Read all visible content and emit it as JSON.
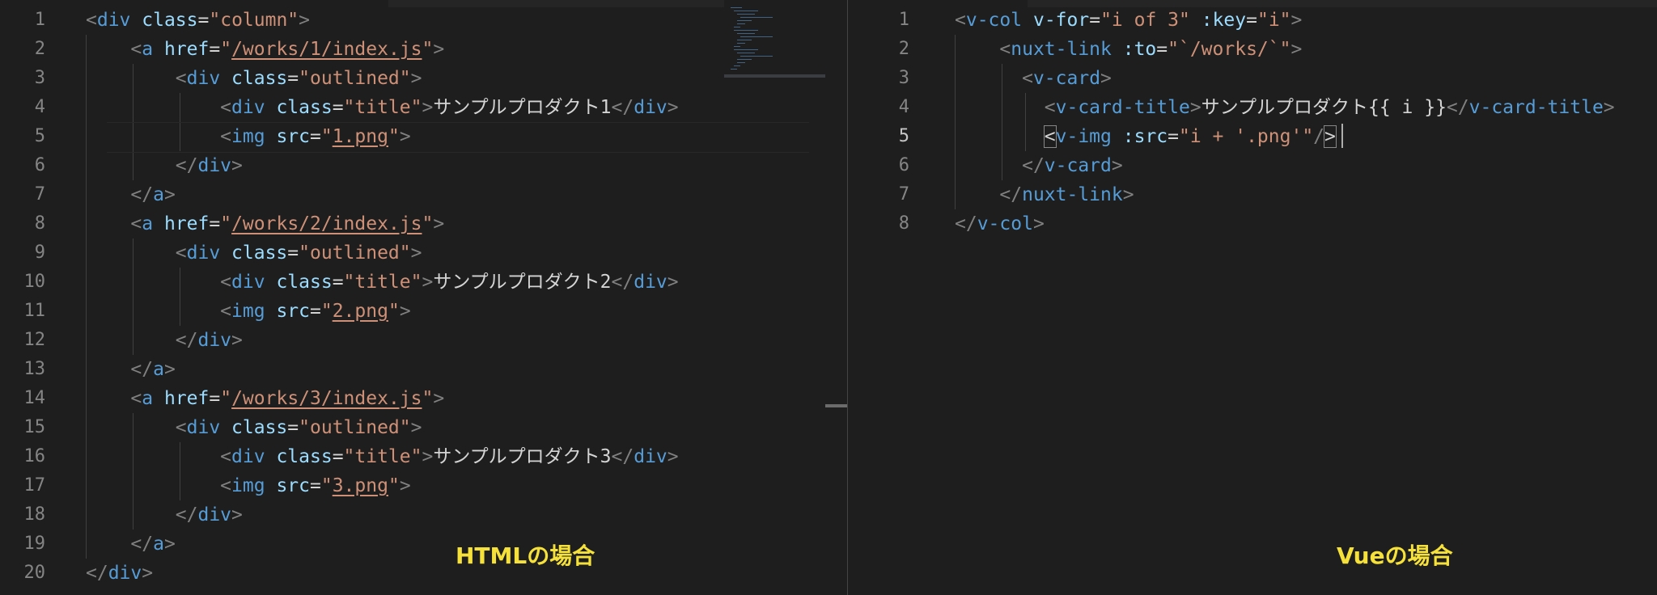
{
  "left_editor": {
    "caption": "HTMLの場合",
    "lines": [
      [
        [
          "brk",
          "<"
        ],
        [
          "tag",
          "div"
        ],
        [
          "txt",
          " "
        ],
        [
          "attr",
          "class"
        ],
        [
          "txt",
          "="
        ],
        [
          "str",
          "\"column\""
        ],
        [
          "brk",
          ">"
        ]
      ],
      [
        [
          "txt",
          "    "
        ],
        [
          "brk",
          "<"
        ],
        [
          "tag",
          "a"
        ],
        [
          "txt",
          " "
        ],
        [
          "attr",
          "href"
        ],
        [
          "txt",
          "="
        ],
        [
          "str",
          "\""
        ],
        [
          "link",
          "/works/1/index.js"
        ],
        [
          "str",
          "\""
        ],
        [
          "brk",
          ">"
        ]
      ],
      [
        [
          "txt",
          "        "
        ],
        [
          "brk",
          "<"
        ],
        [
          "tag",
          "div"
        ],
        [
          "txt",
          " "
        ],
        [
          "attr",
          "class"
        ],
        [
          "txt",
          "="
        ],
        [
          "str",
          "\"outlined\""
        ],
        [
          "brk",
          ">"
        ]
      ],
      [
        [
          "txt",
          "            "
        ],
        [
          "brk",
          "<"
        ],
        [
          "tag",
          "div"
        ],
        [
          "txt",
          " "
        ],
        [
          "attr",
          "class"
        ],
        [
          "txt",
          "="
        ],
        [
          "str",
          "\"title\""
        ],
        [
          "brk",
          ">"
        ],
        [
          "txt",
          "サンプルプロダクト1"
        ],
        [
          "brk",
          "</"
        ],
        [
          "tag",
          "div"
        ],
        [
          "brk",
          ">"
        ]
      ],
      [
        [
          "txt",
          "            "
        ],
        [
          "brk",
          "<"
        ],
        [
          "tag",
          "img"
        ],
        [
          "txt",
          " "
        ],
        [
          "attr",
          "src"
        ],
        [
          "txt",
          "="
        ],
        [
          "str",
          "\""
        ],
        [
          "link",
          "1.png"
        ],
        [
          "str",
          "\""
        ],
        [
          "brk",
          ">"
        ]
      ],
      [
        [
          "txt",
          "        "
        ],
        [
          "brk",
          "</"
        ],
        [
          "tag",
          "div"
        ],
        [
          "brk",
          ">"
        ]
      ],
      [
        [
          "txt",
          "    "
        ],
        [
          "brk",
          "</"
        ],
        [
          "tag",
          "a"
        ],
        [
          "brk",
          ">"
        ]
      ],
      [
        [
          "txt",
          "    "
        ],
        [
          "brk",
          "<"
        ],
        [
          "tag",
          "a"
        ],
        [
          "txt",
          " "
        ],
        [
          "attr",
          "href"
        ],
        [
          "txt",
          "="
        ],
        [
          "str",
          "\""
        ],
        [
          "link",
          "/works/2/index.js"
        ],
        [
          "str",
          "\""
        ],
        [
          "brk",
          ">"
        ]
      ],
      [
        [
          "txt",
          "        "
        ],
        [
          "brk",
          "<"
        ],
        [
          "tag",
          "div"
        ],
        [
          "txt",
          " "
        ],
        [
          "attr",
          "class"
        ],
        [
          "txt",
          "="
        ],
        [
          "str",
          "\"outlined\""
        ],
        [
          "brk",
          ">"
        ]
      ],
      [
        [
          "txt",
          "            "
        ],
        [
          "brk",
          "<"
        ],
        [
          "tag",
          "div"
        ],
        [
          "txt",
          " "
        ],
        [
          "attr",
          "class"
        ],
        [
          "txt",
          "="
        ],
        [
          "str",
          "\"title\""
        ],
        [
          "brk",
          ">"
        ],
        [
          "txt",
          "サンプルプロダクト2"
        ],
        [
          "brk",
          "</"
        ],
        [
          "tag",
          "div"
        ],
        [
          "brk",
          ">"
        ]
      ],
      [
        [
          "txt",
          "            "
        ],
        [
          "brk",
          "<"
        ],
        [
          "tag",
          "img"
        ],
        [
          "txt",
          " "
        ],
        [
          "attr",
          "src"
        ],
        [
          "txt",
          "="
        ],
        [
          "str",
          "\""
        ],
        [
          "link",
          "2.png"
        ],
        [
          "str",
          "\""
        ],
        [
          "brk",
          ">"
        ]
      ],
      [
        [
          "txt",
          "        "
        ],
        [
          "brk",
          "</"
        ],
        [
          "tag",
          "div"
        ],
        [
          "brk",
          ">"
        ]
      ],
      [
        [
          "txt",
          "    "
        ],
        [
          "brk",
          "</"
        ],
        [
          "tag",
          "a"
        ],
        [
          "brk",
          ">"
        ]
      ],
      [
        [
          "txt",
          "    "
        ],
        [
          "brk",
          "<"
        ],
        [
          "tag",
          "a"
        ],
        [
          "txt",
          " "
        ],
        [
          "attr",
          "href"
        ],
        [
          "txt",
          "="
        ],
        [
          "str",
          "\""
        ],
        [
          "link",
          "/works/3/index.js"
        ],
        [
          "str",
          "\""
        ],
        [
          "brk",
          ">"
        ]
      ],
      [
        [
          "txt",
          "        "
        ],
        [
          "brk",
          "<"
        ],
        [
          "tag",
          "div"
        ],
        [
          "txt",
          " "
        ],
        [
          "attr",
          "class"
        ],
        [
          "txt",
          "="
        ],
        [
          "str",
          "\"outlined\""
        ],
        [
          "brk",
          ">"
        ]
      ],
      [
        [
          "txt",
          "            "
        ],
        [
          "brk",
          "<"
        ],
        [
          "tag",
          "div"
        ],
        [
          "txt",
          " "
        ],
        [
          "attr",
          "class"
        ],
        [
          "txt",
          "="
        ],
        [
          "str",
          "\"title\""
        ],
        [
          "brk",
          ">"
        ],
        [
          "txt",
          "サンプルプロダクト3"
        ],
        [
          "brk",
          "</"
        ],
        [
          "tag",
          "div"
        ],
        [
          "brk",
          ">"
        ]
      ],
      [
        [
          "txt",
          "            "
        ],
        [
          "brk",
          "<"
        ],
        [
          "tag",
          "img"
        ],
        [
          "txt",
          " "
        ],
        [
          "attr",
          "src"
        ],
        [
          "txt",
          "="
        ],
        [
          "str",
          "\""
        ],
        [
          "link",
          "3.png"
        ],
        [
          "str",
          "\""
        ],
        [
          "brk",
          ">"
        ]
      ],
      [
        [
          "txt",
          "        "
        ],
        [
          "brk",
          "</"
        ],
        [
          "tag",
          "div"
        ],
        [
          "brk",
          ">"
        ]
      ],
      [
        [
          "txt",
          "    "
        ],
        [
          "brk",
          "</"
        ],
        [
          "tag",
          "a"
        ],
        [
          "brk",
          ">"
        ]
      ],
      [
        [
          "brk",
          "</"
        ],
        [
          "tag",
          "div"
        ],
        [
          "brk",
          ">"
        ]
      ]
    ]
  },
  "right_editor": {
    "caption": "Vueの場合",
    "active_line": 5,
    "lines": [
      [
        [
          "brk",
          "<"
        ],
        [
          "tag",
          "v-col"
        ],
        [
          "txt",
          " "
        ],
        [
          "attr",
          "v-for"
        ],
        [
          "txt",
          "="
        ],
        [
          "str",
          "\"i of 3\""
        ],
        [
          "txt",
          " "
        ],
        [
          "attr",
          ":key"
        ],
        [
          "txt",
          "="
        ],
        [
          "str",
          "\"i\""
        ],
        [
          "brk",
          ">"
        ]
      ],
      [
        [
          "txt",
          "    "
        ],
        [
          "brk",
          "<"
        ],
        [
          "tag",
          "nuxt-link"
        ],
        [
          "txt",
          " "
        ],
        [
          "attr",
          ":to"
        ],
        [
          "txt",
          "="
        ],
        [
          "str",
          "\"`/works/`\""
        ],
        [
          "brk",
          ">"
        ]
      ],
      [
        [
          "txt",
          "      "
        ],
        [
          "brk",
          "<"
        ],
        [
          "tag",
          "v-card"
        ],
        [
          "brk",
          ">"
        ]
      ],
      [
        [
          "txt",
          "        "
        ],
        [
          "brk",
          "<"
        ],
        [
          "tag",
          "v-card-title"
        ],
        [
          "brk",
          ">"
        ],
        [
          "txt",
          "サンプルプロダクト{{ i }}"
        ],
        [
          "brk",
          "</"
        ],
        [
          "tag",
          "v-card-title"
        ],
        [
          "brk",
          ">"
        ]
      ],
      [
        [
          "txt",
          "        "
        ],
        [
          "br",
          "<"
        ],
        [
          "tag",
          "v-img"
        ],
        [
          "txt",
          " "
        ],
        [
          "attr",
          ":src"
        ],
        [
          "txt",
          "="
        ],
        [
          "str",
          "\"i + '.png'\""
        ],
        [
          "brk",
          "/"
        ],
        [
          "br",
          ">"
        ]
      ],
      [
        [
          "txt",
          "      "
        ],
        [
          "brk",
          "</"
        ],
        [
          "tag",
          "v-card"
        ],
        [
          "brk",
          ">"
        ]
      ],
      [
        [
          "txt",
          "    "
        ],
        [
          "brk",
          "</"
        ],
        [
          "tag",
          "nuxt-link"
        ],
        [
          "brk",
          ">"
        ]
      ],
      [
        [
          "brk",
          "</"
        ],
        [
          "tag",
          "v-col"
        ],
        [
          "brk",
          ">"
        ]
      ]
    ]
  }
}
